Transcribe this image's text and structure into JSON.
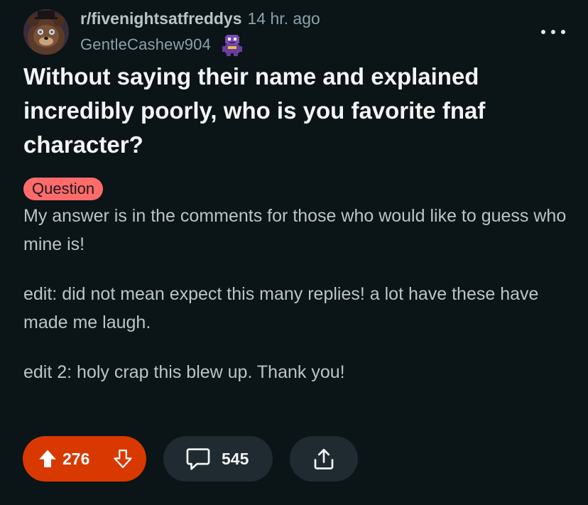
{
  "post": {
    "subreddit": "r/fivenightsatfreddys",
    "timestamp": "14 hr. ago",
    "username": "GentleCashew904",
    "title": "Without saying their name and explained incredibly poorly, who is you favorite fnaf character?",
    "flair": "Question",
    "body": [
      "My answer is in the comments for those who would like to guess who mine is!",
      "edit: did not mean expect this many replies! a lot have these have made me laugh.",
      "edit 2: holy crap this blew up. Thank you!"
    ]
  },
  "actions": {
    "votes": "276",
    "comments": "545"
  },
  "colors": {
    "background": "#0b1416",
    "flair_bg": "#ff6b6b",
    "upvoted": "#d93900",
    "pill_bg": "#1f2b30",
    "user_flair": "#7b4bb0"
  },
  "icons": {
    "avatar": "freddy-avatar",
    "user_flair": "purple-guy-pixel-icon",
    "more": "more-options-icon",
    "upvote": "upvote-arrow-icon",
    "downvote": "downvote-arrow-icon",
    "comment": "comment-bubble-icon",
    "share": "share-icon"
  }
}
